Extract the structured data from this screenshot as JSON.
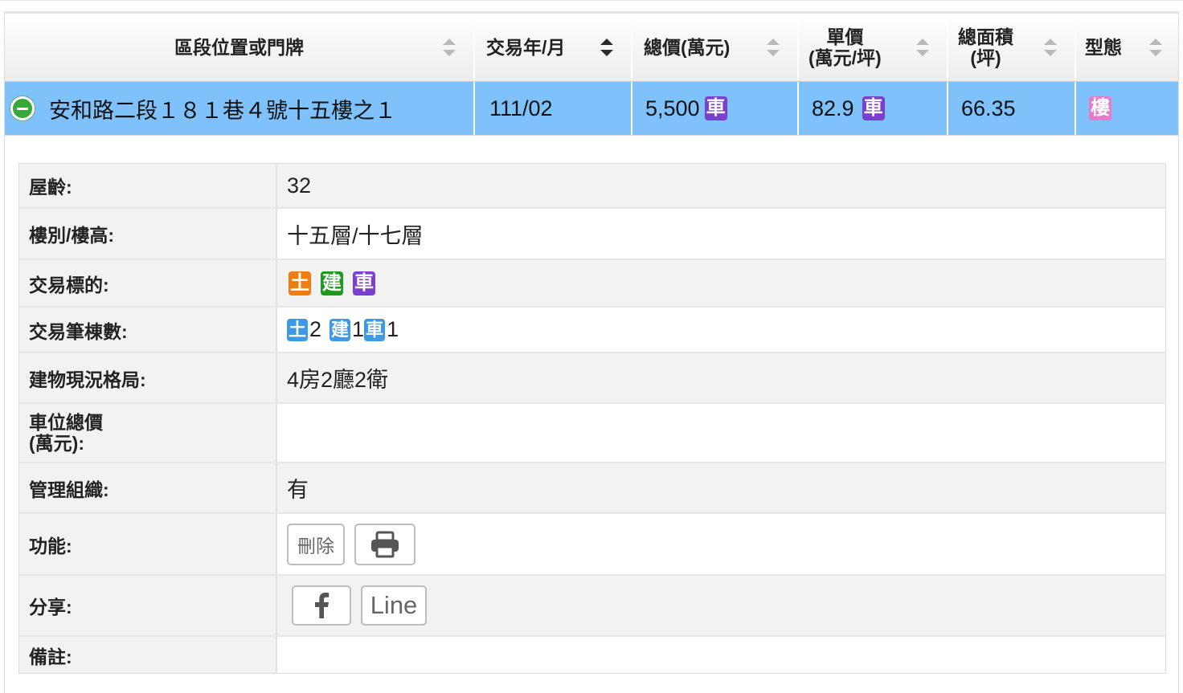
{
  "columns": [
    {
      "label": "區段位置或門牌",
      "lines": [
        "區段位置或門牌"
      ],
      "sort": "none"
    },
    {
      "label": "交易年/月",
      "lines": [
        "交易年/月"
      ],
      "sort": "active"
    },
    {
      "label": "總價(萬元)",
      "lines": [
        "總價(萬元)"
      ],
      "sort": "none"
    },
    {
      "label": "單價(萬元/坪)",
      "lines": [
        "單價",
        "(萬元/坪)"
      ],
      "sort": "none"
    },
    {
      "label": "總面積(坪)",
      "lines": [
        "總面積",
        "(坪)"
      ],
      "sort": "none"
    },
    {
      "label": "型態",
      "lines": [
        "型態"
      ],
      "sort": "none"
    }
  ],
  "selected_row": {
    "address": "安和路二段１８１巷４號十五樓之１",
    "date": "111/02",
    "total_price": "5,500",
    "total_price_tag": "車",
    "unit_price": "82.9",
    "unit_price_tag": "車",
    "area": "66.35",
    "type_tag": "樓"
  },
  "detail": {
    "age_label": "屋齡:",
    "age_value": "32",
    "floor_label": "樓別/樓高:",
    "floor_value": "十五層/十七層",
    "target_label": "交易標的:",
    "target_tags": [
      "土",
      "建",
      "車"
    ],
    "count_label": "交易筆棟數:",
    "counts": [
      {
        "tag": "土",
        "n": "2"
      },
      {
        "tag": "建",
        "n": "1"
      },
      {
        "tag": "車",
        "n": "1"
      }
    ],
    "layout_label": "建物現況格局:",
    "layout_value": "4房2廳2衛",
    "parking_label_1": "車位總價",
    "parking_label_2": "(萬元):",
    "parking_value": "",
    "mgmt_label": "管理組織:",
    "mgmt_value": "有",
    "func_label": "功能:",
    "delete_label": "刪除",
    "share_label": "分享:",
    "line_label": "Line",
    "note_label": "備註:",
    "note_value": ""
  },
  "colors": {
    "selected_row_bg": "#7fc1fb",
    "tag_purple": "#7b3fd0",
    "tag_pink": "#e57bc9",
    "tag_orange": "#f07d10",
    "tag_green": "#1e9a1e",
    "tag_blue": "#3f98e3",
    "collapse_green": "#39a83a"
  },
  "icons": [
    "collapse-minus-icon",
    "sort-icon",
    "print-icon",
    "facebook-icon"
  ]
}
